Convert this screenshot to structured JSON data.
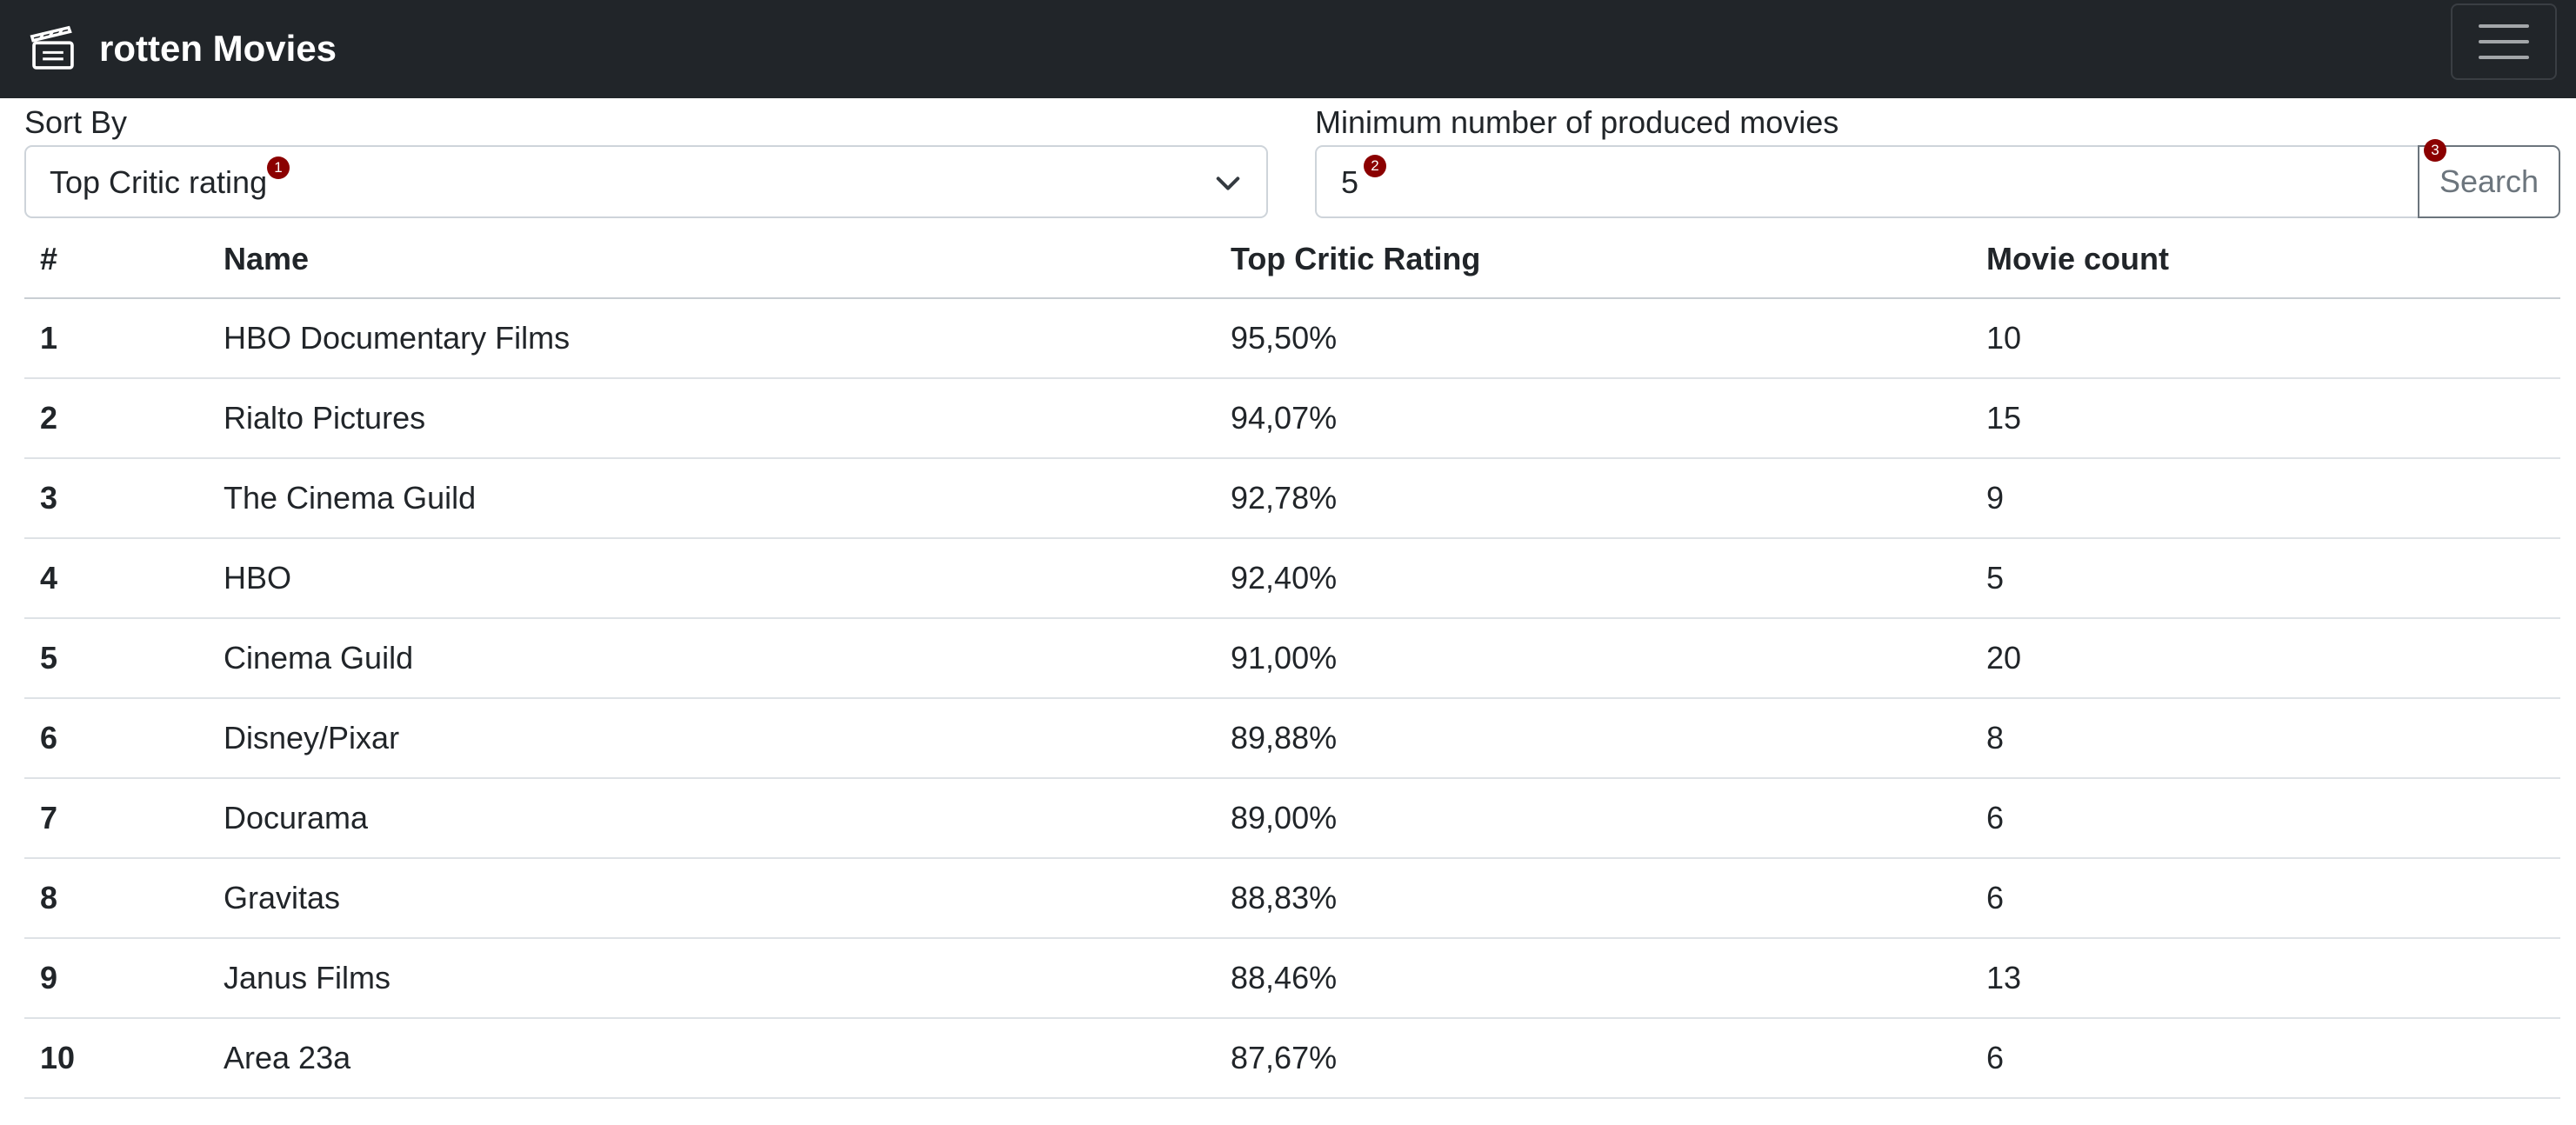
{
  "app": {
    "title": "rotten Movies",
    "logo_icon": "clapperboard-icon",
    "menu_icon": "hamburger-menu-icon"
  },
  "filters": {
    "sort_label": "Sort By",
    "sort_value": "Top Critic rating",
    "min_label": "Minimum number of produced movies",
    "min_value": "5",
    "search_label": "Search",
    "badges": [
      "1",
      "2",
      "3"
    ]
  },
  "table": {
    "headers": [
      "#",
      "Name",
      "Top Critic Rating",
      "Movie count"
    ],
    "rows": [
      {
        "rank": "1",
        "name": "HBO Documentary Films",
        "rating": "95,50%",
        "count": "10"
      },
      {
        "rank": "2",
        "name": "Rialto Pictures",
        "rating": "94,07%",
        "count": "15"
      },
      {
        "rank": "3",
        "name": "The Cinema Guild",
        "rating": "92,78%",
        "count": "9"
      },
      {
        "rank": "4",
        "name": "HBO",
        "rating": "92,40%",
        "count": "5"
      },
      {
        "rank": "5",
        "name": "Cinema Guild",
        "rating": "91,00%",
        "count": "20"
      },
      {
        "rank": "6",
        "name": "Disney/Pixar",
        "rating": "89,88%",
        "count": "8"
      },
      {
        "rank": "7",
        "name": "Docurama",
        "rating": "89,00%",
        "count": "6"
      },
      {
        "rank": "8",
        "name": "Gravitas",
        "rating": "88,83%",
        "count": "6"
      },
      {
        "rank": "9",
        "name": "Janus Films",
        "rating": "88,46%",
        "count": "13"
      },
      {
        "rank": "10",
        "name": "Area 23a",
        "rating": "87,67%",
        "count": "6"
      }
    ]
  },
  "colors": {
    "navbar": "#212529",
    "badge": "#8b0000",
    "text": "#212529",
    "button_outline": "#6c757d"
  }
}
